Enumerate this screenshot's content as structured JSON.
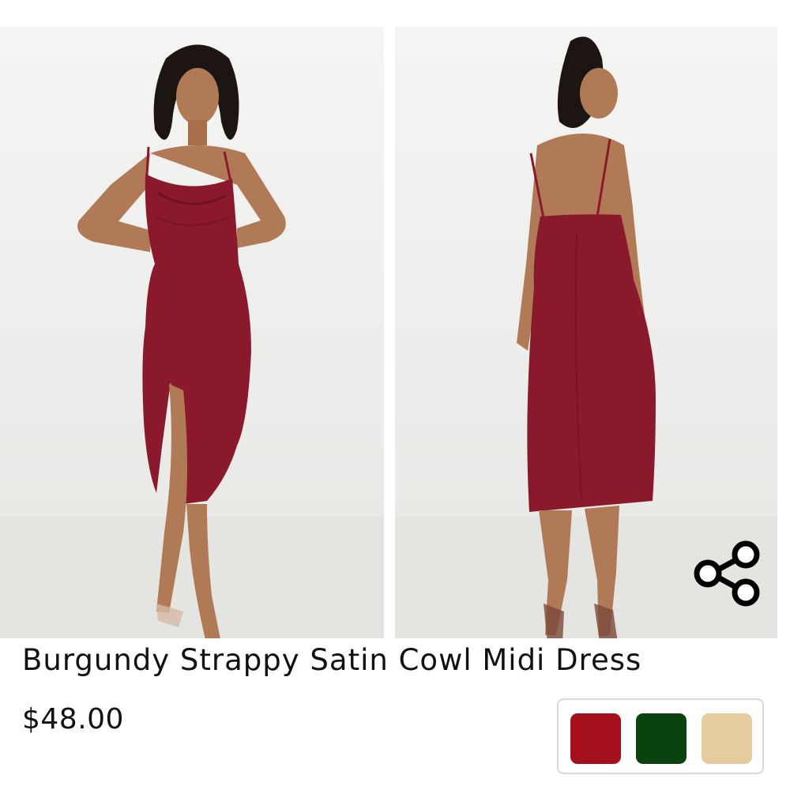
{
  "product": {
    "title": "Burgundy Strappy Satin Cowl Midi Dress",
    "price": "$48.00"
  },
  "gallery": {
    "images": [
      {
        "name": "front-view-photo"
      },
      {
        "name": "back-view-photo"
      }
    ]
  },
  "share": {
    "icon": "share-icon"
  },
  "swatches": [
    {
      "name": "burgundy",
      "color": "#a4101b"
    },
    {
      "name": "green",
      "color": "#0a4210"
    },
    {
      "name": "nude",
      "color": "#e3cc9d"
    }
  ],
  "colors": {
    "dress": "#8a1a2b",
    "skin": "#b17a56",
    "hair": "#1d1512"
  }
}
